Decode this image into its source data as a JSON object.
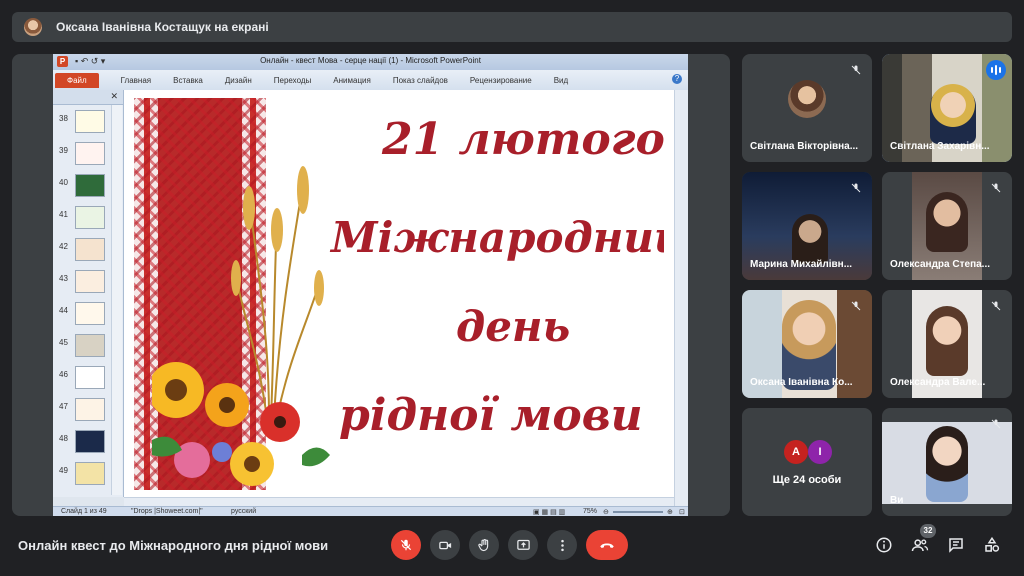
{
  "presenter_bar": {
    "text": "Оксана Іванівна Костащук на екрані"
  },
  "powerpoint": {
    "window_title": "Онлайн - квест Мова - серце нації (1)  -  Microsoft PowerPoint",
    "logo_letter": "P",
    "file_tab": "Файл",
    "tabs": [
      "Главная",
      "Вставка",
      "Дизайн",
      "Переходы",
      "Анимация",
      "Показ слайдов",
      "Рецензирование",
      "Вид"
    ],
    "thumbnails": [
      "38",
      "39",
      "40",
      "41",
      "42",
      "43",
      "44",
      "45",
      "46",
      "47",
      "48",
      "49"
    ],
    "status": {
      "slide_info": "Слайд 1 из 49",
      "theme": "\"Drops |Showeet.com|\"",
      "language": "русский",
      "zoom": "75%"
    },
    "slide": {
      "line1": "21 лютого -",
      "line2": "Міжнародний",
      "line3": "день",
      "line4": "рідної мови",
      "text_color": "#a81f2a"
    }
  },
  "participants": [
    {
      "name": "Світлана Вікторівна...",
      "muted": true
    },
    {
      "name": "Світлана Захарівн...",
      "speaking": true
    },
    {
      "name": "Марина Михайлівн...",
      "muted": true
    },
    {
      "name": "Олександра Степа...",
      "muted": true
    },
    {
      "name": "Оксана Іванівна Ко...",
      "muted": true
    },
    {
      "name": "Олександра Вале...",
      "muted": true
    },
    {
      "name": "Ви",
      "muted": true
    }
  ],
  "more": {
    "avatar_letters": [
      "А",
      "І"
    ],
    "avatar_colors": [
      "#c5221f",
      "#8e24aa"
    ],
    "label": "Ще 24 особи"
  },
  "bottom": {
    "meeting_title": "Онлайн квест до Міжнародного дня рідної мови",
    "people_count": "32"
  },
  "icons": {
    "mic": "mic-off-icon",
    "camera": "camera-icon",
    "hand": "raise-hand-icon",
    "present": "present-screen-icon",
    "more": "more-vert-icon",
    "hangup": "hangup-icon",
    "info": "info-icon",
    "people": "people-icon",
    "chat": "chat-icon",
    "activities": "activities-icon"
  },
  "colors": {
    "background": "#202124",
    "tile": "#3c4043",
    "danger": "#ea4335",
    "accent": "#1a73e8"
  }
}
